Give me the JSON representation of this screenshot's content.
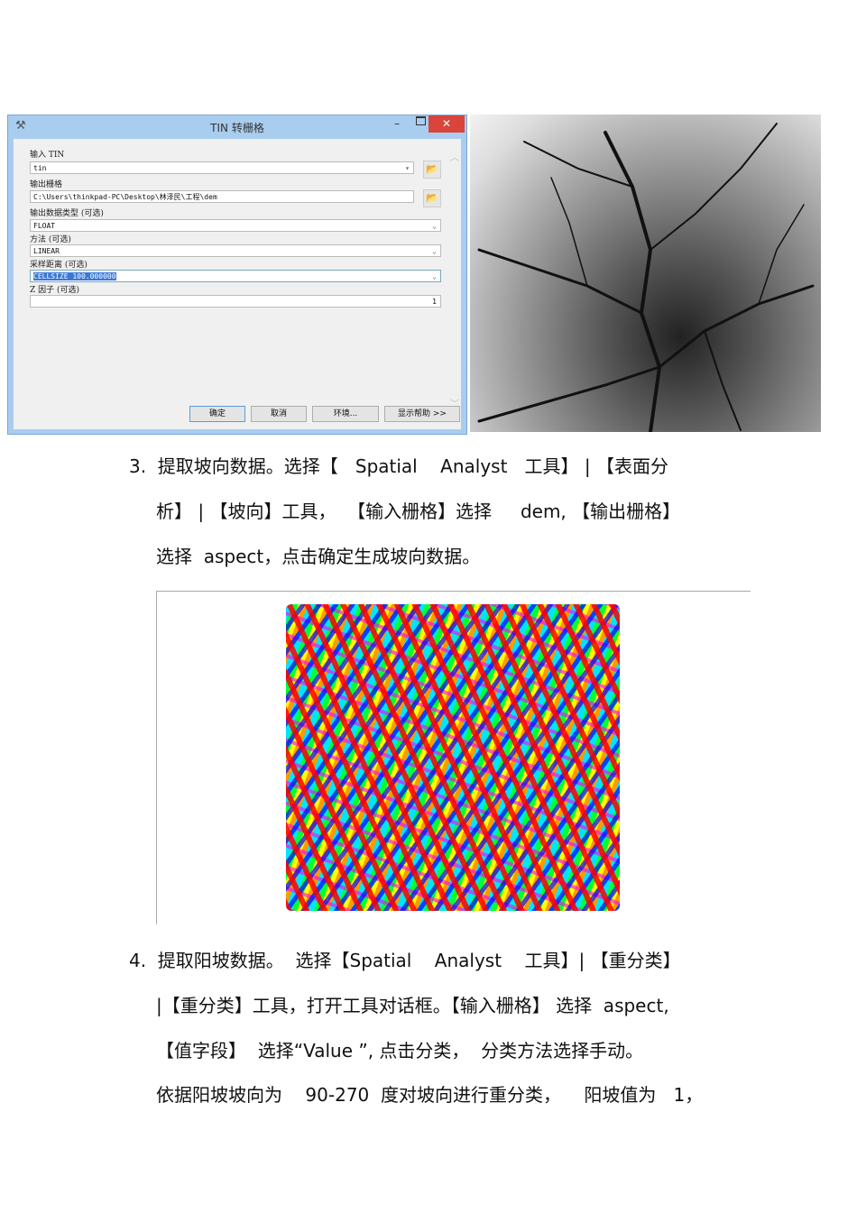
{
  "dialog": {
    "title": "TIN 转栅格",
    "input_tin_label": "输入 TIN",
    "input_tin_value": "tin",
    "output_raster_label": "输出栅格",
    "output_raster_value": "C:\\Users\\thinkpad-PC\\Desktop\\林泽民\\工程\\dem",
    "data_type_label": "输出数据类型 (可选)",
    "data_type_value": "FLOAT",
    "method_label": "方法 (可选)",
    "method_value": "LINEAR",
    "sampling_label": "采样距离 (可选)",
    "sampling_value": "CELLSIZE 100.000000",
    "zfactor_label": "Z 因子 (可选)",
    "zfactor_value": "1",
    "ok": "确定",
    "cancel": "取消",
    "env": "环境...",
    "help": "显示帮助 >>"
  },
  "step3": {
    "line1": "3.  提取坡向数据。选择【   Spatial    Analyst   工具】 | 【表面分",
    "line2": "析】 | 【坡向】工具，  【输入栅格】选择     dem, 【输出栅格】",
    "line3": "选择  aspect，点击确定生成坡向数据。"
  },
  "step4": {
    "line1": "4.  提取阳坡数据。  选择【Spatial    Analyst    工具】| 【重分类】",
    "line2": "|【重分类】工具，打开工具对话框。【输入栅格】 选择  aspect,",
    "line3": "【值字段】  选择“Value ”, 点击分类，  分类方法选择手动。",
    "line4": "依据阳坡坡向为    90-270  度对坡向进行重分类，    阳坡值为   1，"
  }
}
